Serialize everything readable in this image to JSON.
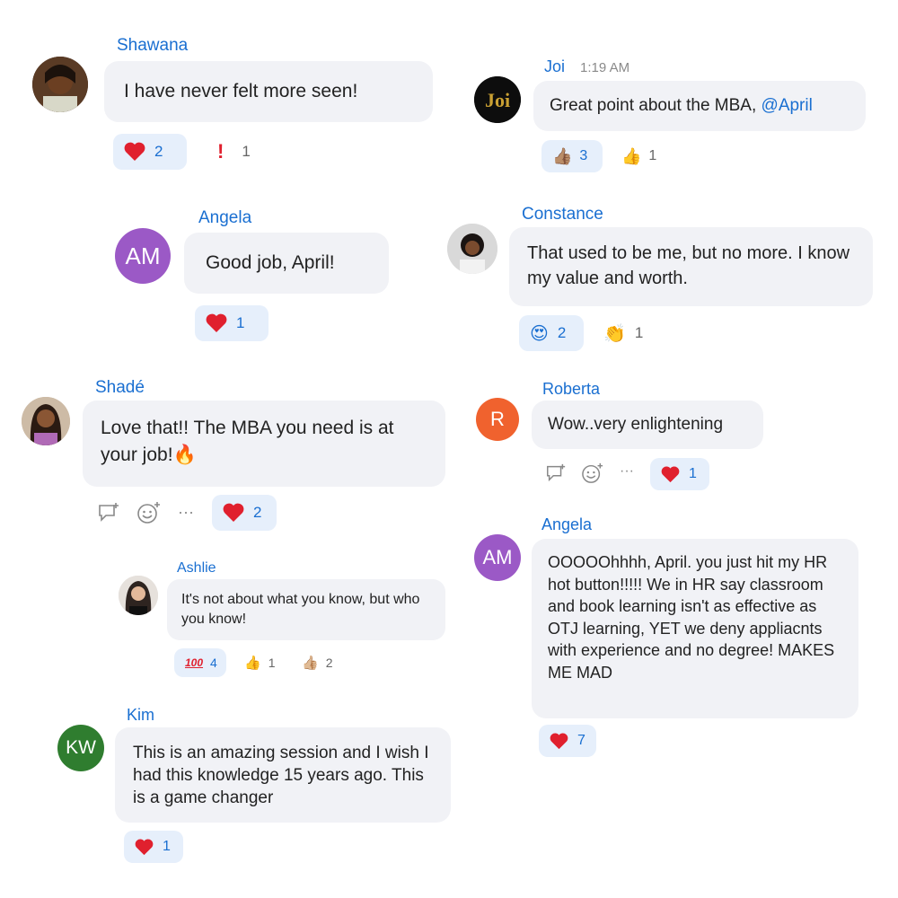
{
  "messages": {
    "shawana": {
      "name": "Shawana",
      "text": "I have never felt more seen!",
      "reactions": {
        "heart": "2",
        "exclaim": "1"
      }
    },
    "joi": {
      "name": "Joi",
      "time": "1:19 AM",
      "text": "Great point about the MBA, ",
      "mention": "@April",
      "reactions": {
        "thumb_tan": "3",
        "thumb_yellow": "1"
      }
    },
    "angela1": {
      "name": "Angela",
      "initials": "AM",
      "text": "Good job, April!",
      "reactions": {
        "heart": "1"
      }
    },
    "constance": {
      "name": "Constance",
      "text": "That used to be me, but no more. I know my value and worth.",
      "reactions": {
        "heart_eyes": "2",
        "clap": "1"
      }
    },
    "shade": {
      "name": "Shadé",
      "text": "Love that!! The MBA you need is at your job!🔥",
      "reactions": {
        "heart": "2"
      },
      "tools": {
        "more": "···"
      }
    },
    "roberta": {
      "name": "Roberta",
      "initials": "R",
      "text": "Wow..very enlightening",
      "reactions": {
        "heart": "1"
      },
      "tools": {
        "more": "···"
      }
    },
    "ashlie": {
      "name": "Ashlie",
      "text": "It's not about what you know, but who you know!",
      "reactions": {
        "hundred": "4",
        "thumb_yellow": "1",
        "thumb_tan": "2"
      }
    },
    "angela2": {
      "name": "Angela",
      "initials": "AM",
      "text": "OOOOOhhhh, April. you just hit my HR hot button!!!!! We in HR say classroom and book learning isn't as effective as OTJ learning, YET we deny appliacnts with experience and no degree! MAKES ME MAD",
      "reactions": {
        "heart": "7"
      }
    },
    "kim": {
      "name": "Kim",
      "initials": "KW",
      "text": "This is an amazing session and I wish I had this knowledge 15 years ago. This is a game changer",
      "reactions": {
        "heart": "1"
      }
    }
  },
  "colors": {
    "accent": "#1a6fd1",
    "bubble": "#f1f2f6",
    "reaction_active": "#e6effb",
    "heart": "#e0202e",
    "avatar_purple": "#9b59c6",
    "avatar_orange": "#f0622e",
    "avatar_green": "#2f7d2f"
  },
  "icons": {
    "heart": "heart-icon",
    "exclaim": "exclamation-icon",
    "thumb": "thumbs-up-icon",
    "heart_eyes": "heart-eyes-icon",
    "clap": "clap-icon",
    "hundred": "hundred-icon",
    "reply": "reply-icon",
    "emoji": "add-emoji-icon",
    "more": "more-icon"
  }
}
